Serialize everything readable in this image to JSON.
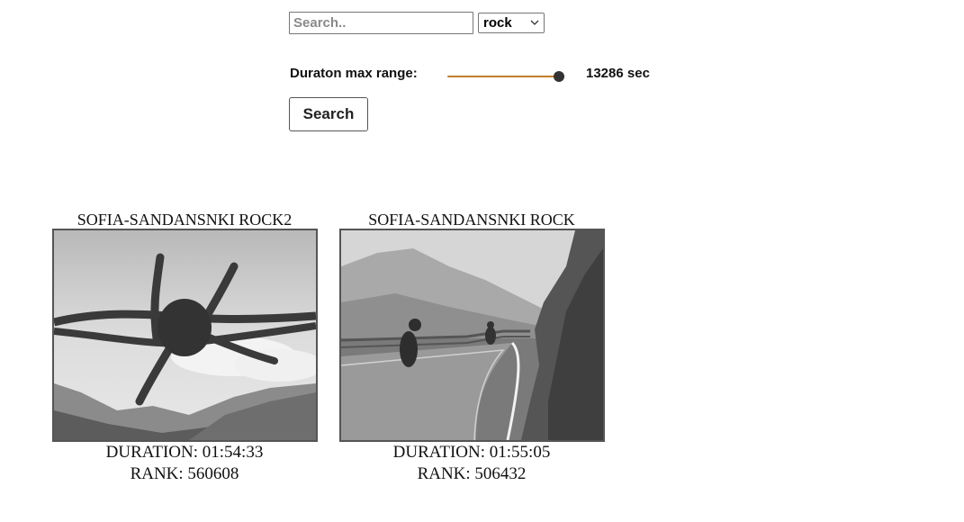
{
  "search": {
    "placeholder": "Search..",
    "value": ""
  },
  "genre_select": {
    "selected": "rock"
  },
  "duration_filter": {
    "label": "Duraton max range:",
    "value_text": "13286 sec",
    "slider_fraction": 0.95,
    "accent_color": "#c47f2c"
  },
  "search_button": {
    "label": "Search"
  },
  "results": [
    {
      "title": "SOFIA-SANDANSNKI ROCK2",
      "duration": "DURATION: 01:54:33",
      "rank": "RANK: 560608",
      "thumbnail": "barbed-wire-photo"
    },
    {
      "title": "SOFIA-SANDANSNKI ROCK",
      "duration": "DURATION: 01:55:05",
      "rank": "RANK: 506432",
      "thumbnail": "mountain-road-motorcycles-photo"
    }
  ]
}
